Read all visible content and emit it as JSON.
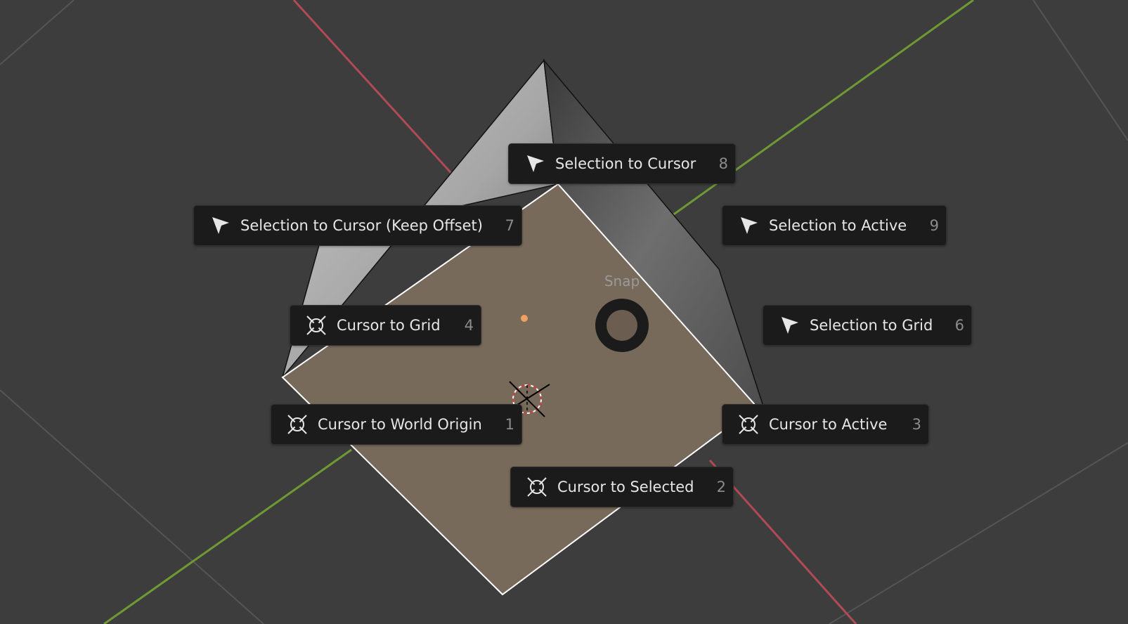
{
  "pie_menu": {
    "title": "Snap",
    "items": [
      {
        "label": "Selection to Cursor",
        "shortcut": "8",
        "icon": "selection-arrow-icon"
      },
      {
        "label": "Selection to Cursor (Keep Offset)",
        "shortcut": "7",
        "icon": "selection-arrow-icon"
      },
      {
        "label": "Selection to Active",
        "shortcut": "9",
        "icon": "selection-arrow-icon"
      },
      {
        "label": "Cursor to Grid",
        "shortcut": "4",
        "icon": "cursor-crosshair-icon"
      },
      {
        "label": "Selection to Grid",
        "shortcut": "6",
        "icon": "selection-arrow-icon"
      },
      {
        "label": "Cursor to World Origin",
        "shortcut": "1",
        "icon": "cursor-crosshair-icon"
      },
      {
        "label": "Cursor to Active",
        "shortcut": "3",
        "icon": "cursor-crosshair-icon"
      },
      {
        "label": "Cursor to Selected",
        "shortcut": "2",
        "icon": "cursor-crosshair-icon"
      }
    ]
  },
  "colors": {
    "background": "#3d3d3d",
    "menu_bg": "#1b1b1b",
    "x_axis": "#b04a55",
    "y_axis": "#6f9a33",
    "selected_face": "#786a5b",
    "origin_dot": "#f0a060"
  }
}
